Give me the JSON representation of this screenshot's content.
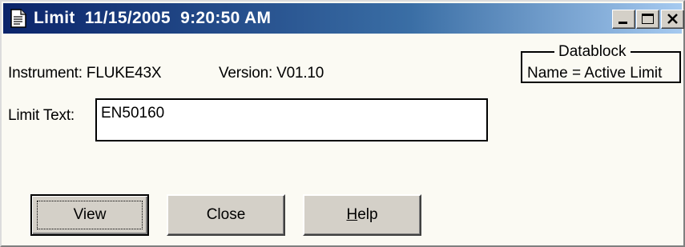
{
  "window": {
    "title": "Limit  11/15/2005  9:20:50 AM",
    "icon": "document-icon",
    "caption_buttons": [
      "minimize-icon",
      "maximize-icon",
      "close-icon"
    ]
  },
  "info": {
    "instrument": "Instrument: FLUKE43X",
    "version": "Version: V01.10"
  },
  "datablock": {
    "title": "Datablock",
    "content": "Name = Active Limit"
  },
  "limit": {
    "label": "Limit Text:",
    "value": "EN50160"
  },
  "buttons": {
    "view": "View",
    "close": "Close",
    "help_mnemonic": "H",
    "help_rest": "elp"
  },
  "colors": {
    "titlebar_start": "#0a246a",
    "titlebar_end": "#a6caf0",
    "button_face": "#d4d0c8"
  }
}
